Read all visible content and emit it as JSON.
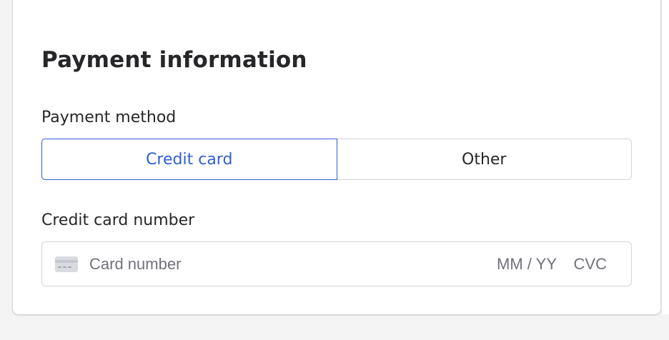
{
  "section": {
    "title": "Payment information"
  },
  "payment_method": {
    "label": "Payment method",
    "options": [
      {
        "label": "Credit card",
        "selected": true
      },
      {
        "label": "Other",
        "selected": false
      }
    ],
    "accent_color": "#2f5fd3"
  },
  "credit_card": {
    "label": "Credit card number",
    "number_placeholder": "Card number",
    "expiry_placeholder": "MM / YY",
    "cvc_placeholder": "CVC",
    "icon": "credit-card-icon"
  }
}
